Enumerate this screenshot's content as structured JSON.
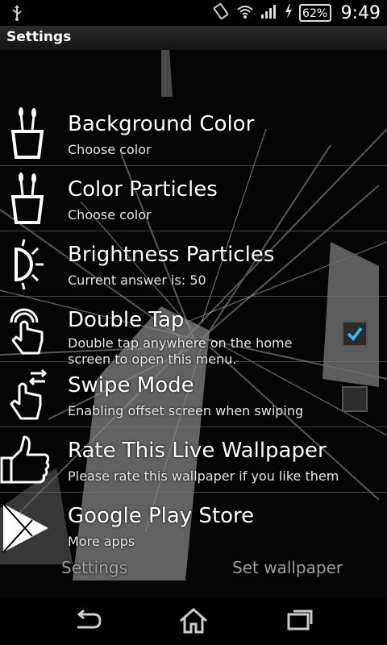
{
  "status_bar": {
    "battery": "62%",
    "time": "9:49",
    "icons": [
      "usb-icon",
      "rotate-icon",
      "wifi-icon",
      "signal-icon",
      "charging-icon",
      "battery-icon"
    ]
  },
  "action_bar": {
    "title": "Settings"
  },
  "settings": [
    {
      "icon": "paint-brushes-icon",
      "title": "Background Color",
      "subtitle": "Choose color"
    },
    {
      "icon": "paint-brushes-icon",
      "title": "Color Particles",
      "subtitle": "Choose color"
    },
    {
      "icon": "brightness-icon",
      "title": "Brightness Particles",
      "subtitle": "Current answer is: 50"
    },
    {
      "icon": "tap-hand-icon",
      "title": "Double Tap",
      "subtitle": "Double tap anywhere on the home screen to open this menu.",
      "checked": true
    },
    {
      "icon": "swipe-hand-icon",
      "title": "Swipe Mode",
      "subtitle": "Enabling offset screen when swiping",
      "checked": false
    },
    {
      "icon": "thumbs-up-icon",
      "title": "Rate This Live Wallpaper",
      "subtitle": "Please rate this wallpaper if you like them"
    },
    {
      "icon": "play-store-icon",
      "title": "Google Play Store",
      "subtitle": "More apps"
    }
  ],
  "bottom_buttons": {
    "settings": "Settings",
    "set_wallpaper": "Set wallpaper"
  },
  "nav_bar": {
    "icons": [
      "back-icon",
      "home-icon",
      "recent-apps-icon"
    ]
  },
  "colors": {
    "checkmark": "#33b5e5",
    "background": "#000000"
  }
}
